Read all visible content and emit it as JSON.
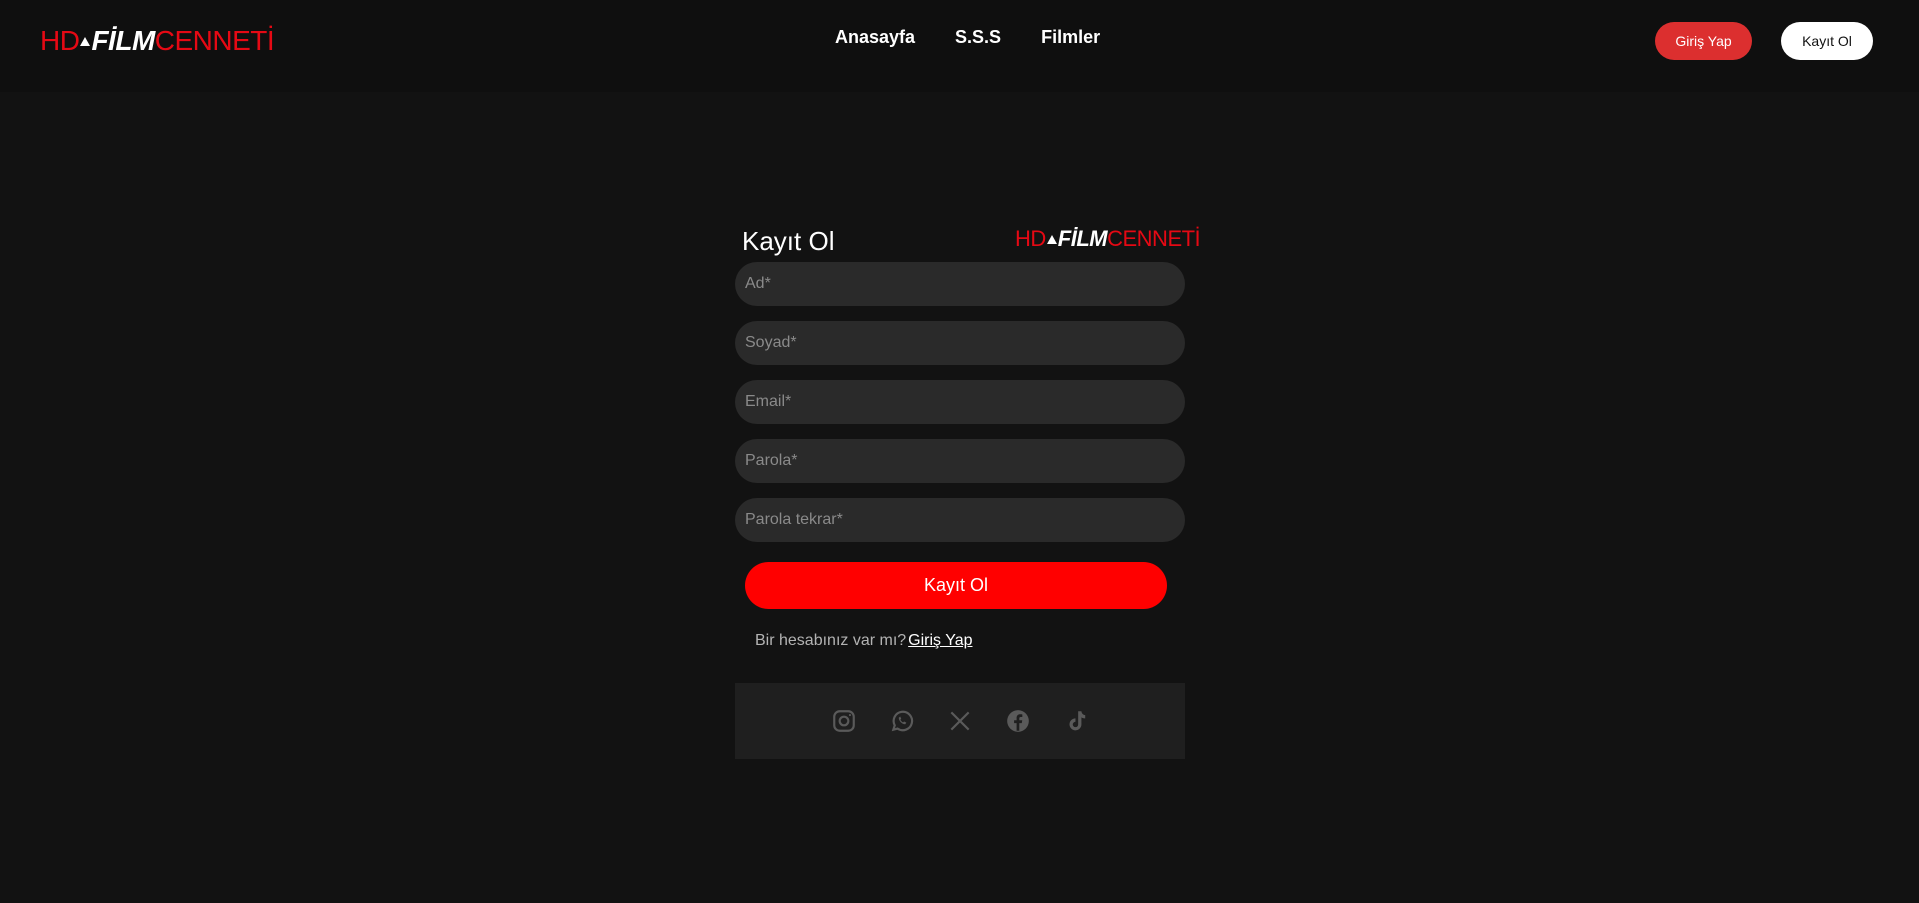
{
  "header": {
    "logo": {
      "hd": "HD",
      "film": "FİLM",
      "cenneti": "CENNETİ"
    },
    "nav": [
      "Anasayfa",
      "S.S.S",
      "Filmler"
    ],
    "login_label": "Giriş Yap",
    "register_label": "Kayıt Ol"
  },
  "form": {
    "title": "Kayıt Ol",
    "logo": {
      "hd": "HD",
      "film": "FİLM",
      "cenneti": "CENNETİ"
    },
    "fields": [
      {
        "placeholder": "Ad*",
        "value": ""
      },
      {
        "placeholder": "Soyad*",
        "value": ""
      },
      {
        "placeholder": "Email*",
        "value": ""
      },
      {
        "placeholder": "Parola*",
        "value": ""
      },
      {
        "placeholder": "Parola tekrar*",
        "value": ""
      }
    ],
    "submit_label": "Kayıt Ol",
    "login_question": "Bir hesabınız var mı?",
    "login_link": "Giriş Yap"
  },
  "social": [
    "instagram-icon",
    "whatsapp-icon",
    "x-icon",
    "facebook-icon",
    "tiktok-icon"
  ],
  "colors": {
    "accent": "#ff0000",
    "brand": "#e50914",
    "background": "#121212",
    "icon": "#5a5a5a"
  }
}
